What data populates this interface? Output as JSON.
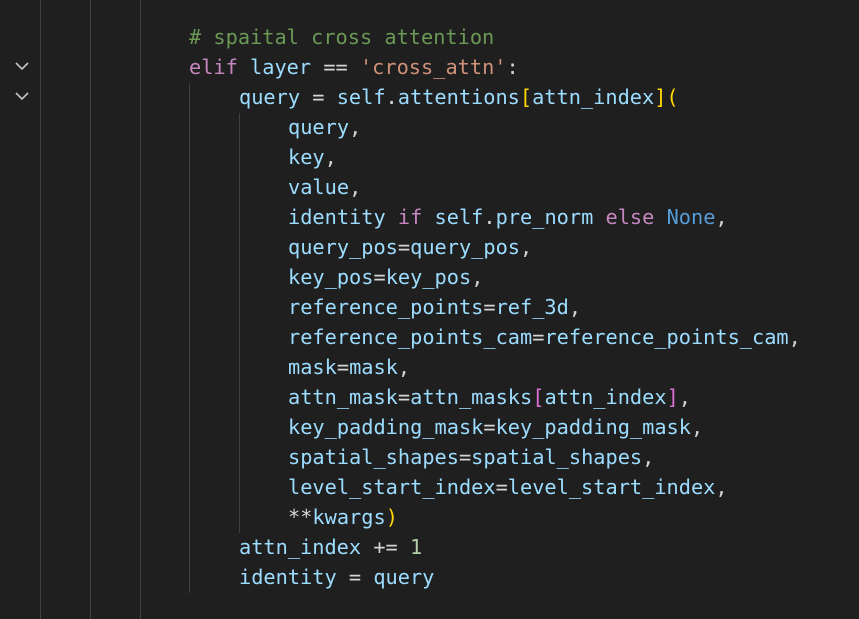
{
  "editor": {
    "theme": "dark",
    "colors": {
      "background": "#1f1f1f",
      "comment": "#6a9955",
      "keyword_control": "#c586c0",
      "keyword_constant": "#569cd6",
      "string": "#ce9178",
      "variable": "#9cdcfe",
      "operator": "#d4d4d4",
      "number": "#b5cea8",
      "bracket_level1": "#ffd700",
      "bracket_level2": "#da70d6"
    },
    "fold_icons": [
      "chevron-down-icon",
      "chevron-down-icon"
    ],
    "lines": [
      [
        {
          "t": "# spaital cross attention",
          "c": "comment"
        }
      ],
      [
        {
          "t": "elif",
          "c": "kw"
        },
        {
          "t": " layer ",
          "c": "var"
        },
        {
          "t": "==",
          "c": "op"
        },
        {
          "t": " ",
          "c": "op"
        },
        {
          "t": "'cross_attn'",
          "c": "str"
        },
        {
          "t": ":",
          "c": "op"
        }
      ],
      [
        {
          "t": "query",
          "c": "var"
        },
        {
          "t": " = ",
          "c": "op"
        },
        {
          "t": "self",
          "c": "var"
        },
        {
          "t": ".",
          "c": "op"
        },
        {
          "t": "attentions",
          "c": "var"
        },
        {
          "t": "[",
          "c": "br1"
        },
        {
          "t": "attn_index",
          "c": "var"
        },
        {
          "t": "]",
          "c": "br1"
        },
        {
          "t": "(",
          "c": "br1"
        }
      ],
      [
        {
          "t": "query",
          "c": "var"
        },
        {
          "t": ",",
          "c": "op"
        }
      ],
      [
        {
          "t": "key",
          "c": "var"
        },
        {
          "t": ",",
          "c": "op"
        }
      ],
      [
        {
          "t": "value",
          "c": "var"
        },
        {
          "t": ",",
          "c": "op"
        }
      ],
      [
        {
          "t": "identity",
          "c": "var"
        },
        {
          "t": " ",
          "c": "op"
        },
        {
          "t": "if",
          "c": "kw"
        },
        {
          "t": " ",
          "c": "op"
        },
        {
          "t": "self",
          "c": "var"
        },
        {
          "t": ".",
          "c": "op"
        },
        {
          "t": "pre_norm",
          "c": "var"
        },
        {
          "t": " ",
          "c": "op"
        },
        {
          "t": "else",
          "c": "kw"
        },
        {
          "t": " ",
          "c": "op"
        },
        {
          "t": "None",
          "c": "kw2"
        },
        {
          "t": ",",
          "c": "op"
        }
      ],
      [
        {
          "t": "query_pos",
          "c": "var"
        },
        {
          "t": "=",
          "c": "op"
        },
        {
          "t": "query_pos",
          "c": "var"
        },
        {
          "t": ",",
          "c": "op"
        }
      ],
      [
        {
          "t": "key_pos",
          "c": "var"
        },
        {
          "t": "=",
          "c": "op"
        },
        {
          "t": "key_pos",
          "c": "var"
        },
        {
          "t": ",",
          "c": "op"
        }
      ],
      [
        {
          "t": "reference_points",
          "c": "var"
        },
        {
          "t": "=",
          "c": "op"
        },
        {
          "t": "ref_3d",
          "c": "var"
        },
        {
          "t": ",",
          "c": "op"
        }
      ],
      [
        {
          "t": "reference_points_cam",
          "c": "var"
        },
        {
          "t": "=",
          "c": "op"
        },
        {
          "t": "reference_points_cam",
          "c": "var"
        },
        {
          "t": ",",
          "c": "op"
        }
      ],
      [
        {
          "t": "mask",
          "c": "var"
        },
        {
          "t": "=",
          "c": "op"
        },
        {
          "t": "mask",
          "c": "var"
        },
        {
          "t": ",",
          "c": "op"
        }
      ],
      [
        {
          "t": "attn_mask",
          "c": "var"
        },
        {
          "t": "=",
          "c": "op"
        },
        {
          "t": "attn_masks",
          "c": "var"
        },
        {
          "t": "[",
          "c": "br2"
        },
        {
          "t": "attn_index",
          "c": "var"
        },
        {
          "t": "]",
          "c": "br2"
        },
        {
          "t": ",",
          "c": "op"
        }
      ],
      [
        {
          "t": "key_padding_mask",
          "c": "var"
        },
        {
          "t": "=",
          "c": "op"
        },
        {
          "t": "key_padding_mask",
          "c": "var"
        },
        {
          "t": ",",
          "c": "op"
        }
      ],
      [
        {
          "t": "spatial_shapes",
          "c": "var"
        },
        {
          "t": "=",
          "c": "op"
        },
        {
          "t": "spatial_shapes",
          "c": "var"
        },
        {
          "t": ",",
          "c": "op"
        }
      ],
      [
        {
          "t": "level_start_index",
          "c": "var"
        },
        {
          "t": "=",
          "c": "op"
        },
        {
          "t": "level_start_index",
          "c": "var"
        },
        {
          "t": ",",
          "c": "op"
        }
      ],
      [
        {
          "t": "**",
          "c": "op"
        },
        {
          "t": "kwargs",
          "c": "var"
        },
        {
          "t": ")",
          "c": "br1"
        }
      ],
      [
        {
          "t": "attn_index",
          "c": "var"
        },
        {
          "t": " ",
          "c": "op"
        },
        {
          "t": "+=",
          "c": "op"
        },
        {
          "t": " ",
          "c": "op"
        },
        {
          "t": "1",
          "c": "num"
        }
      ],
      [
        {
          "t": "identity",
          "c": "var"
        },
        {
          "t": " = ",
          "c": "op"
        },
        {
          "t": "query",
          "c": "var"
        }
      ]
    ]
  }
}
